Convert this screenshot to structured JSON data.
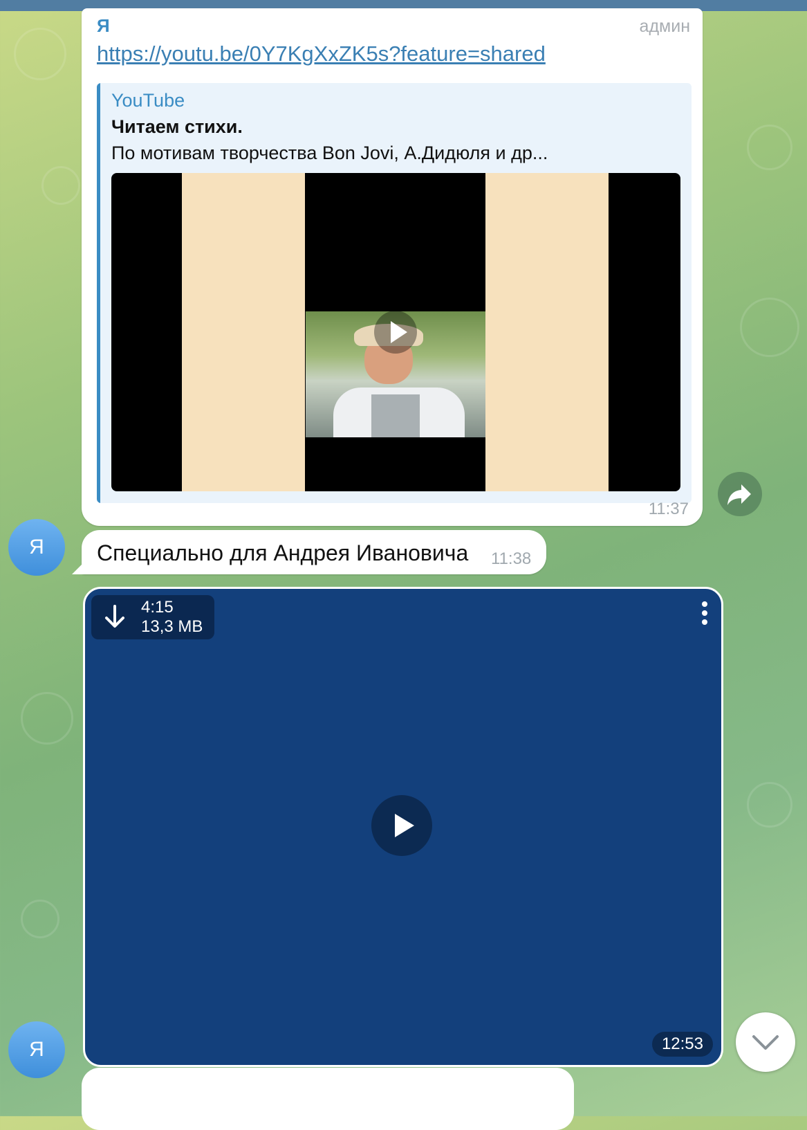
{
  "topbar": {
    "color": "#517da2"
  },
  "message1": {
    "sender": "Я",
    "role": "админ",
    "link": "https://youtu.be/0Y7KgXxZK5s?feature=shared",
    "preview": {
      "site": "YouTube",
      "title": "Читаем стихи.",
      "description": "По мотивам творчества Bon Jovi, А.Дидюля и др..."
    },
    "time": "11:37"
  },
  "message2": {
    "avatar_letter": "Я",
    "text": "Специально для Андрея Ивановича",
    "time": "11:38"
  },
  "message3": {
    "avatar_letter": "Я",
    "video": {
      "duration": "4:15",
      "size": "13,3 MB",
      "time": "12:53"
    }
  },
  "icons": {
    "share": "share-arrow-icon",
    "download": "download-arrow-icon",
    "menu": "more-vertical-icon",
    "play": "play-icon",
    "scroll": "chevron-down-icon"
  },
  "colors": {
    "accent": "#3a8cc4",
    "video_bg": "#13407c",
    "avatar": "#4a97e0"
  }
}
